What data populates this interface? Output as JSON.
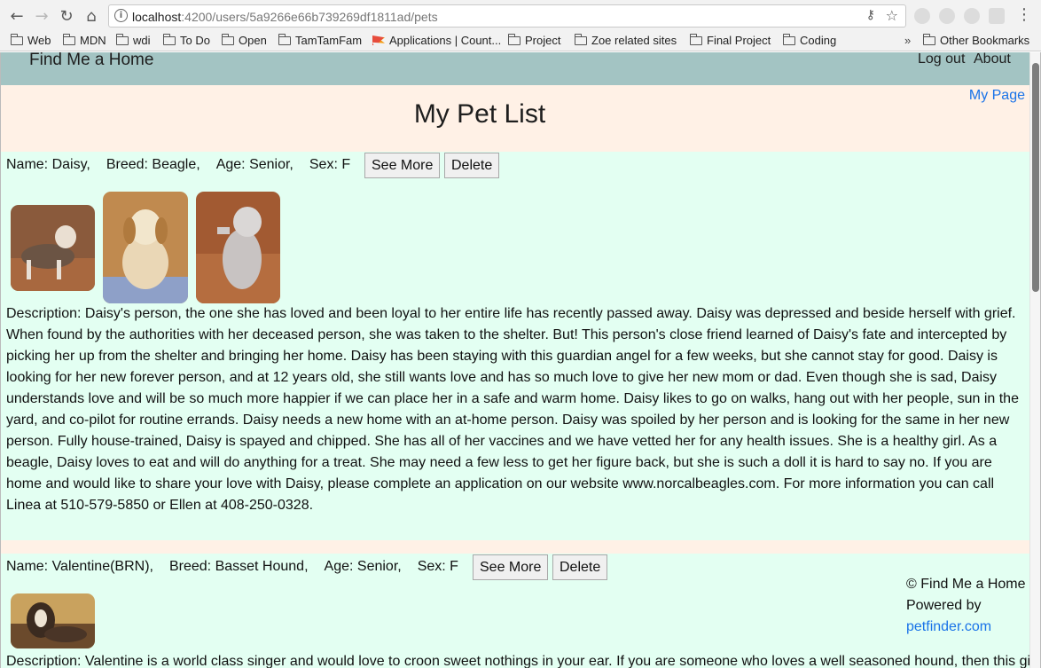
{
  "browser": {
    "url_host": "localhost",
    "url_path": ":4200/users/5a9266e66b739269df1811ad/pets"
  },
  "bookmarks": {
    "items": [
      "Web",
      "MDN",
      "wdi",
      "To Do",
      "Open",
      "TamTamFam",
      "Applications | Count...",
      "Project",
      "Zoe related sites",
      "Final Project",
      "Coding"
    ],
    "more": "»",
    "other": "Other Bookmarks"
  },
  "nav": {
    "brand": "Find Me a Home",
    "logout": "Log out",
    "about": "About"
  },
  "page": {
    "my_page_link": "My Page",
    "title": "My Pet List"
  },
  "pets": [
    {
      "name": "Name: Daisy,",
      "breed": "Breed: Beagle,",
      "age": "Age: Senior,",
      "sex": "Sex: F",
      "see_more": "See More",
      "delete": "Delete",
      "description": "Description: Daisy's person, the one she has loved and been loyal to her entire life has recently passed away. Daisy was depressed and beside herself with grief. When found by the authorities with her deceased person, she was taken to the shelter. But! This person's close friend learned of Daisy's fate and intercepted by picking her up from the shelter and bringing her home. Daisy has been staying with this guardian angel for a few weeks, but she cannot stay for good. Daisy is looking for her new forever person, and at 12 years old, she still wants love and has so much love to give her new mom or dad. Even though she is sad, Daisy understands love and will be so much more happier if we can place her in a safe and warm home. Daisy likes to go on walks, hang out with her people, sun in the yard, and co-pilot for routine errands. Daisy needs a new home with an at-home person. Daisy was spoiled by her person and is looking for the same in her new person. Fully house-trained, Daisy is spayed and chipped. She has all of her vaccines and we have vetted her for any health issues. She is a healthy girl. As a beagle, Daisy loves to eat and will do anything for a treat. She may need a few less to get her figure back, but she is such a doll it is hard to say no. If you are home and would like to share your love with Daisy, please complete an application on our website www.norcalbeagles.com. For more information you can call Linea at 510-579-5850 or Ellen at 408-250-0328."
    },
    {
      "name": "Name: Valentine(BRN),",
      "breed": "Breed: Basset Hound,",
      "age": "Age: Senior,",
      "sex": "Sex: F",
      "see_more": "See More",
      "delete": "Delete",
      "description": "Description: Valentine is a world class singer and would love to croon sweet nothings in your ear. If you are someone who loves a well seasoned hound, then this girl"
    }
  ],
  "footer": {
    "copyright": "© Find Me a Home",
    "powered": "Powered by",
    "link": "petfinder.com"
  }
}
